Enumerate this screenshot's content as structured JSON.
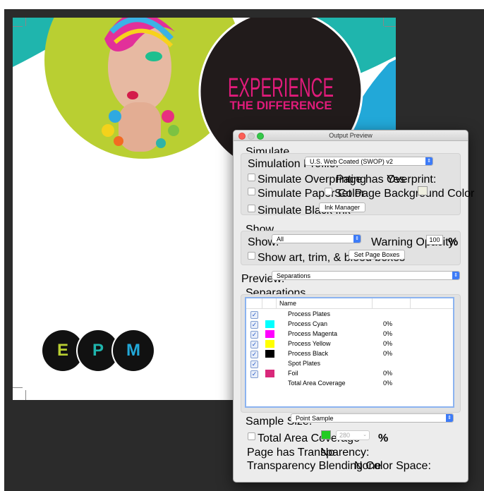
{
  "artwork": {
    "headline_line1": "EXPERIENCE",
    "headline_line2": "THE DIFFERENCE",
    "logo_letters": [
      "E",
      "P",
      "M"
    ],
    "colors": {
      "teal": "#1fb5ad",
      "blue": "#22a8d8",
      "lime": "#b9cf32",
      "dark": "#211b1b",
      "magenta": "#e01b7a"
    }
  },
  "panel": {
    "title": "Output Preview",
    "simulate": {
      "section_label": "Simulate",
      "profile_label": "Simulation Profile:",
      "profile_value": "U.S. Web Coated (SWOP) v2",
      "overprinting_label": "Simulate Overprinting",
      "overprint_status_label": "Page has Overprint:",
      "overprint_status_value": "Yes",
      "paper_color_label": "Simulate Paper Color",
      "page_bg_label": "Set Page Background Color",
      "black_ink_label": "Simulate Black Ink",
      "ink_manager_label": "Ink Manager"
    },
    "show": {
      "section_label": "Show",
      "show_label": "Show:",
      "show_value": "All",
      "warning_label": "Warning Opacity:",
      "warning_value": "100",
      "warning_unit": "%",
      "boxes_label": "Show art, trim, & bleed boxes",
      "page_boxes_button": "Set Page Boxes"
    },
    "preview": {
      "label": "Preview:",
      "value": "Separations"
    },
    "separations": {
      "section_label": "Separations",
      "column_name": "Name",
      "rows": [
        {
          "name": "Process Plates",
          "percent": "",
          "color": ""
        },
        {
          "name": "Process Cyan",
          "percent": "0%",
          "color": "#00ffff"
        },
        {
          "name": "Process Magenta",
          "percent": "0%",
          "color": "#ff00ff"
        },
        {
          "name": "Process Yellow",
          "percent": "0%",
          "color": "#ffff00"
        },
        {
          "name": "Process Black",
          "percent": "0%",
          "color": "#000000"
        },
        {
          "name": "Spot Plates",
          "percent": "",
          "color": ""
        },
        {
          "name": "Foil",
          "percent": "0%",
          "color": "#d9287a"
        },
        {
          "name": "Total Area Coverage",
          "percent": "0%",
          "color": ""
        }
      ]
    },
    "sample": {
      "size_label": "Sample Size:",
      "size_value": "Point Sample",
      "tac_label": "Total Area Coverage",
      "tac_value": "280",
      "tac_unit": "%",
      "tac_color": "#22cc22",
      "transparency_label": "Page has Transparency:",
      "transparency_value": "No",
      "blending_label": "Transparency Blending Color Space:",
      "blending_value": "None"
    }
  }
}
